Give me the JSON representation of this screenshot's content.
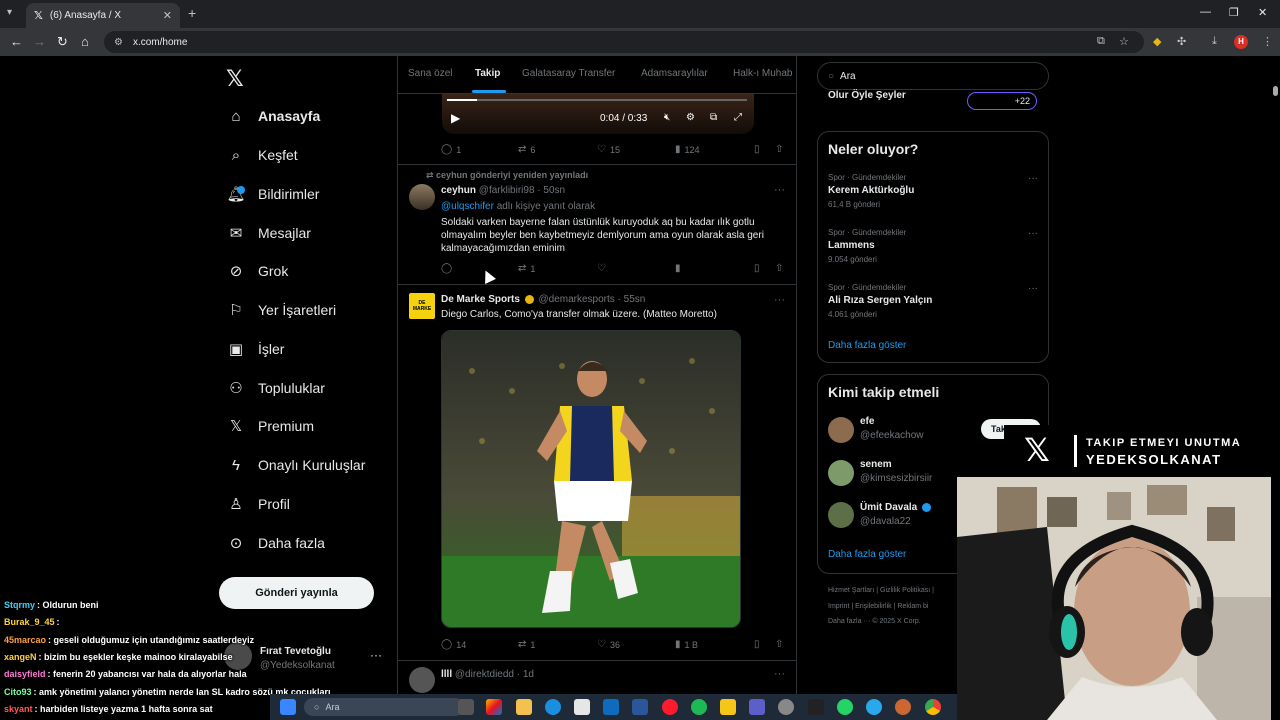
{
  "browser": {
    "tab_title": "(6) Anasayfa / X",
    "url": "x.com/home",
    "profile_initial": "H"
  },
  "nav": {
    "items": [
      {
        "label": "Anasayfa",
        "icon": "home-icon"
      },
      {
        "label": "Keşfet",
        "icon": "search-icon"
      },
      {
        "label": "Bildirimler",
        "icon": "bell-icon"
      },
      {
        "label": "Mesajlar",
        "icon": "mail-icon"
      },
      {
        "label": "Grok",
        "icon": "grok-icon"
      },
      {
        "label": "Yer İşaretleri",
        "icon": "bookmark-icon"
      },
      {
        "label": "İşler",
        "icon": "briefcase-icon"
      },
      {
        "label": "Topluluklar",
        "icon": "people-icon"
      },
      {
        "label": "Premium",
        "icon": "x-icon"
      },
      {
        "label": "Onaylı Kuruluşlar",
        "icon": "lightning-icon"
      },
      {
        "label": "Profil",
        "icon": "person-icon"
      },
      {
        "label": "Daha fazla",
        "icon": "more-circle-icon"
      }
    ],
    "post_button": "Gönderi yayınla",
    "account": {
      "name": "Fırat Tevetoğlu",
      "handle": "@Yedeksolkanat"
    }
  },
  "feed": {
    "tabs": [
      "Sana özel",
      "Takip",
      "Galatasaray Transfer",
      "Adamsaraylılar",
      "Halk-ı Muhab"
    ],
    "active_tab": "Takip",
    "video": {
      "time": "0:04 / 0:33"
    },
    "tweet0_actions": {
      "replies": "1",
      "reposts": "6",
      "likes": "15",
      "views": "124"
    },
    "tweet1": {
      "repost_note": "ceyhun gönderiyi yeniden yayınladı",
      "name": "ceyhun",
      "meta": "@farklibiri98 · 50sn",
      "mention": "@ulqschifer",
      "reply_note": "adlı kişiye yanıt olarak",
      "text": "Soldaki varken bayerne falan üstünlük kuruyoduk aq bu kadar ılık gotlu olmayalım beyler ben kaybetmeyiz demlyorum ama oyun olarak asla geri kalmayacağımızdan eminim",
      "reposts": "1"
    },
    "tweet2": {
      "name": "De Marke Sports",
      "meta": "@demarkesports · 55sn",
      "avatar_text": "DE MARKE",
      "text": "Diego Carlos, Como'ya transfer olmak üzere. (Matteo Moretto)",
      "replies": "14",
      "reposts": "1",
      "likes": "36",
      "views": "1 B"
    },
    "tweet3": {
      "name": "llll",
      "meta": "@direktdiedd · 1d"
    }
  },
  "sidebar": {
    "search_placeholder": "Ara",
    "prev_text": "Olur Öyle Şeyler",
    "prev_count": "+22",
    "trends_title": "Neler oluyor?",
    "trends": [
      {
        "category": "Spor · Gündemdekiler",
        "name": "Kerem Aktürkoğlu",
        "count": "61,4 B gönderi"
      },
      {
        "category": "Spor · Gündemdekiler",
        "name": "Lammens",
        "count": "9.054 gönderi"
      },
      {
        "category": "Spor · Gündemdekiler",
        "name": "Ali Rıza Sergen Yalçın",
        "count": "4.061 gönderi"
      }
    ],
    "show_more": "Daha fazla göster",
    "wtf_title": "Kimi takip etmeli",
    "follow_label": "Takip",
    "wtf": [
      {
        "name": "efe",
        "handle": "@efeekachow"
      },
      {
        "name": "senem",
        "handle": "@kimsesizbirsiir"
      },
      {
        "name": "Ümit Davala",
        "handle": "@davala22"
      }
    ],
    "footer1": "Hizmet Şartları  |  Gizlilik Politikası  |",
    "footer2": "Imprint  |  Erişilebilirlik  |  Reklam bi",
    "footer3": "Daha fazla ···  © 2025 X Corp."
  },
  "overlay": {
    "line1": "TAKIP ETMEYI UNUTMA",
    "line2": "YEDEKSOLKANAT"
  },
  "chat": [
    {
      "user": "Stqrmy",
      "msg": ": Oldurun beni",
      "color": "#3fd0ff"
    },
    {
      "user": "Burak_9_45",
      "msg": ":",
      "color": "#ffd23f"
    },
    {
      "user": "45marcao",
      "msg": ": geseli olduğumuz için utandığımız saatlerdeyiz",
      "color": "#ff9f3f"
    },
    {
      "user": "xangeN",
      "msg": ": bizim bu eşekler keşke mainoo kiralayabilse",
      "color": "#ffd23f"
    },
    {
      "user": "daisyfield",
      "msg": ": fenerin 20 yabancısı var hala da alıyorlar hala",
      "color": "#ff7bd5"
    },
    {
      "user": "Cito93",
      "msg": ": amk yönetimi yalancı yönetim nerde lan SL kadro sözü mk çocukları",
      "color": "#7bff9f"
    },
    {
      "user": "skyant",
      "msg": ": harbiden listeye yazma 1 hafta sonra sat",
      "color": "#ff5a5a"
    }
  ],
  "taskbar": {
    "search": "Ara"
  }
}
